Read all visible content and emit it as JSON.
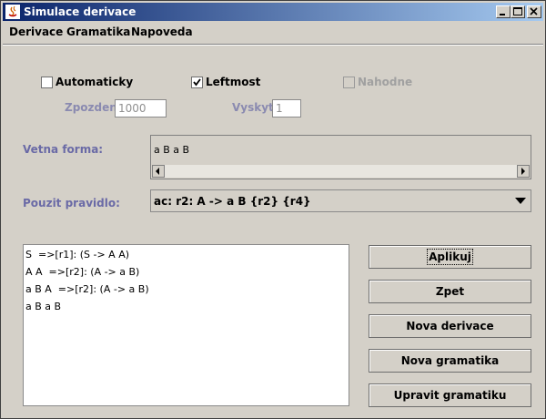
{
  "window": {
    "title": "Simulace derivace"
  },
  "menu": [
    "Derivace",
    "Gramatika",
    "Napoveda"
  ],
  "options": {
    "automaticky": {
      "label": "Automaticky",
      "checked": false
    },
    "leftmost": {
      "label": "Leftmost",
      "checked": true
    },
    "nahodne": {
      "label": "Nahodne",
      "checked": false,
      "disabled": true
    },
    "zpozdeni": {
      "label": "Zpozdeni",
      "value": "1000"
    },
    "vyskyt": {
      "label": "Vyskyt",
      "value": "1"
    }
  },
  "vetna_forma": {
    "label": "Vetna forma:",
    "value": "a B a B"
  },
  "pravidlo": {
    "label": "Pouzit pravidlo:",
    "selected": "ac: r2: A -> a B {r2} {r4}"
  },
  "derivation_steps": [
    "S  =>[r1]: (S -> A A)",
    "A A  =>[r2]: (A -> a B)",
    "a B A  =>[r2]: (A -> a B)",
    "a B a B"
  ],
  "buttons": {
    "aplikuj": "Aplikuj",
    "zpet": "Zpet",
    "nova_derivace": "Nova derivace",
    "nova_gramatika": "Nova gramatika",
    "upravit_gramatiku": "Upravit gramatiku"
  }
}
